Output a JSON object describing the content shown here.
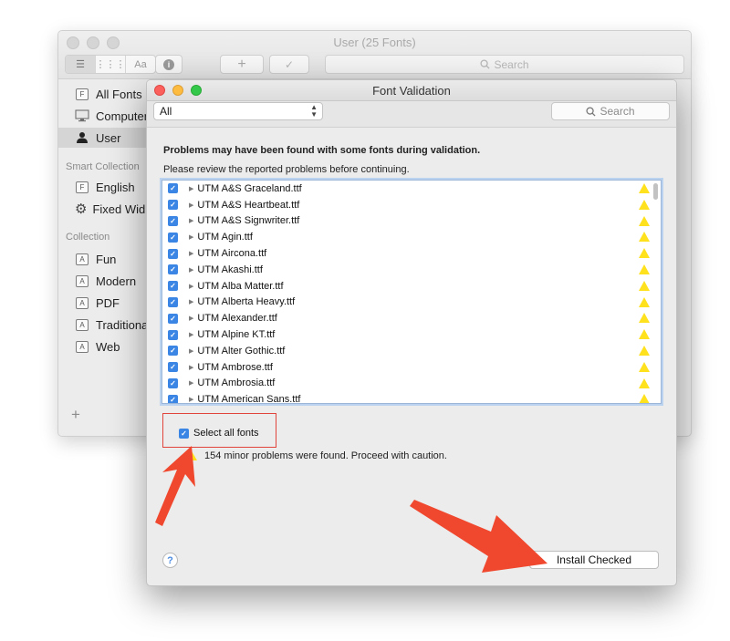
{
  "background_window": {
    "title": "User (25 Fonts)",
    "view_modes": [
      "☰",
      "⋮⋮⋮",
      "Aa"
    ],
    "info_label": "i",
    "add_label": "+",
    "validate_label": "✓",
    "search_placeholder": "Search",
    "sidebar": {
      "items": [
        {
          "label": "All Fonts",
          "icon": "font-file-icon",
          "glyph": "F"
        },
        {
          "label": "Computer",
          "icon": "monitor-icon",
          "glyph": ""
        },
        {
          "label": "User",
          "icon": "user-icon",
          "glyph": ""
        }
      ],
      "smart_collection_heading": "Smart Collection",
      "smart_items": [
        {
          "label": "English",
          "icon": "font-file-icon",
          "glyph": "F"
        },
        {
          "label": "Fixed Wid",
          "icon": "gear-icon",
          "glyph": "⚙"
        }
      ],
      "collection_heading": "Collection",
      "collection_items": [
        {
          "label": "Fun",
          "glyph": "A"
        },
        {
          "label": "Modern",
          "glyph": "A"
        },
        {
          "label": "PDF",
          "glyph": "A"
        },
        {
          "label": "Traditiona",
          "glyph": "A"
        },
        {
          "label": "Web",
          "glyph": "A"
        }
      ],
      "add_label": "+"
    }
  },
  "dialog": {
    "title": "Font Validation",
    "filter": {
      "selected": "All"
    },
    "search_placeholder": "Search",
    "message": "Problems may have been found with some fonts during validation.",
    "submessage": "Please review the reported problems before continuing.",
    "fonts": [
      "UTM A&S Graceland.ttf",
      "UTM A&S Heartbeat.ttf",
      "UTM A&S Signwriter.ttf",
      "UTM Agin.ttf",
      "UTM Aircona.ttf",
      "UTM Akashi.ttf",
      "UTM Alba Matter.ttf",
      "UTM Alberta Heavy.ttf",
      "UTM Alexander.ttf",
      "UTM Alpine KT.ttf",
      "UTM Alter Gothic.ttf",
      "UTM Ambrose.ttf",
      "UTM Ambrosia.ttf",
      "UTM American Sans.ttf"
    ],
    "checkmark": "✓",
    "expand_glyph": "▶",
    "select_all_label": "Select all fonts",
    "problems_text": "154 minor problems were found. Proceed with caution.",
    "help_label": "?",
    "install_label": "Install Checked"
  },
  "colors": {
    "accent": "#3b86e4",
    "warning": "#ffe11d",
    "annotation": "#f0482e",
    "traffic_close": "#fc605c",
    "traffic_min": "#fdbc40",
    "traffic_max": "#34c84a"
  }
}
